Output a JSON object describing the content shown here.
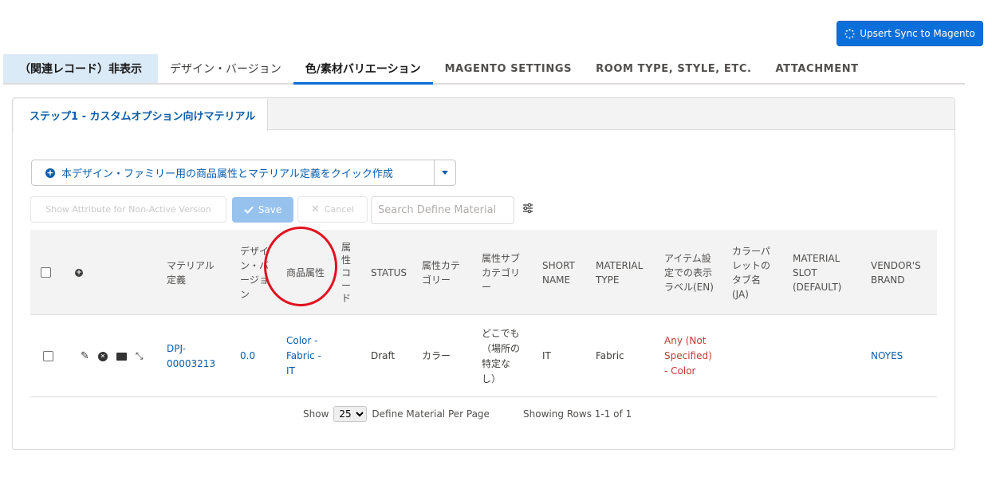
{
  "header": {
    "sync_button": "Upsert Sync to Magento"
  },
  "tabs": [
    {
      "label": "（関連レコード）非表示"
    },
    {
      "label": "デザイン・バージョン"
    },
    {
      "label": "色/素材バリエーション"
    },
    {
      "label": "MAGENTO SETTINGS"
    },
    {
      "label": "ROOM TYPE, STYLE, ETC."
    },
    {
      "label": "ATTACHMENT"
    }
  ],
  "subtab": {
    "label": "ステップ1 - カスタムオプション向けマテリアル"
  },
  "toolbar": {
    "quick_create": "本デザイン・ファミリー用の商品属性とマテリアル定義をクイック作成",
    "show_attr": "Show Attribute for Non-Active Version",
    "save": "Save",
    "cancel": "Cancel",
    "search_placeholder": "Search Define Material"
  },
  "table": {
    "headers": {
      "material": [
        "マテリアル",
        "定義"
      ],
      "version": [
        "デザイ",
        "ン・バ",
        "ージョ",
        "ン"
      ],
      "product_attr": [
        "商品属性"
      ],
      "attr_code": [
        "属",
        "性",
        "コ",
        "ー",
        "ド"
      ],
      "status": [
        "STATUS"
      ],
      "attr_category": [
        "属性カテ",
        "ゴリー"
      ],
      "attr_subcategory": [
        "属性サブ",
        "カテゴリ",
        "ー"
      ],
      "short_name": [
        "SHORT",
        "NAME"
      ],
      "material_type": [
        "MATERIAL",
        "TYPE"
      ],
      "item_label": [
        "アイテム設",
        "定での表示",
        "ラベル(EN)"
      ],
      "palette_tab": [
        "カラーパ",
        "レットの",
        "タブ名",
        "(JA)"
      ],
      "material_slot": [
        "MATERIAL",
        "SLOT",
        "(DEFAULT)"
      ],
      "vendor_brand": [
        "VENDOR'S",
        "BRAND"
      ]
    },
    "rows": [
      {
        "material": [
          "DPJ-",
          "00003213"
        ],
        "version": "0.0",
        "product_attr": [
          "Color -",
          "Fabric -",
          "IT"
        ],
        "attr_code": "",
        "status": "Draft",
        "attr_category": "カラー",
        "attr_subcategory": [
          "どこでも",
          "（場所の",
          "特定**な**",
          "し）"
        ],
        "short_name": "IT",
        "material_type": "Fabric",
        "item_label": [
          "Any (Not",
          "Specified)",
          "- Color"
        ],
        "palette_tab": "",
        "material_slot": "",
        "vendor_brand": "NOYES"
      }
    ]
  },
  "pager": {
    "show": "Show",
    "page_size": "25",
    "per_page": "Define Material Per Page",
    "showing": "Showing Rows 1-1 of 1"
  },
  "colors": {
    "brand_blue": "#0b6fd9",
    "link_blue": "#0b5cab",
    "annotation_red": "#e0121f",
    "label_red": "#c23934"
  }
}
